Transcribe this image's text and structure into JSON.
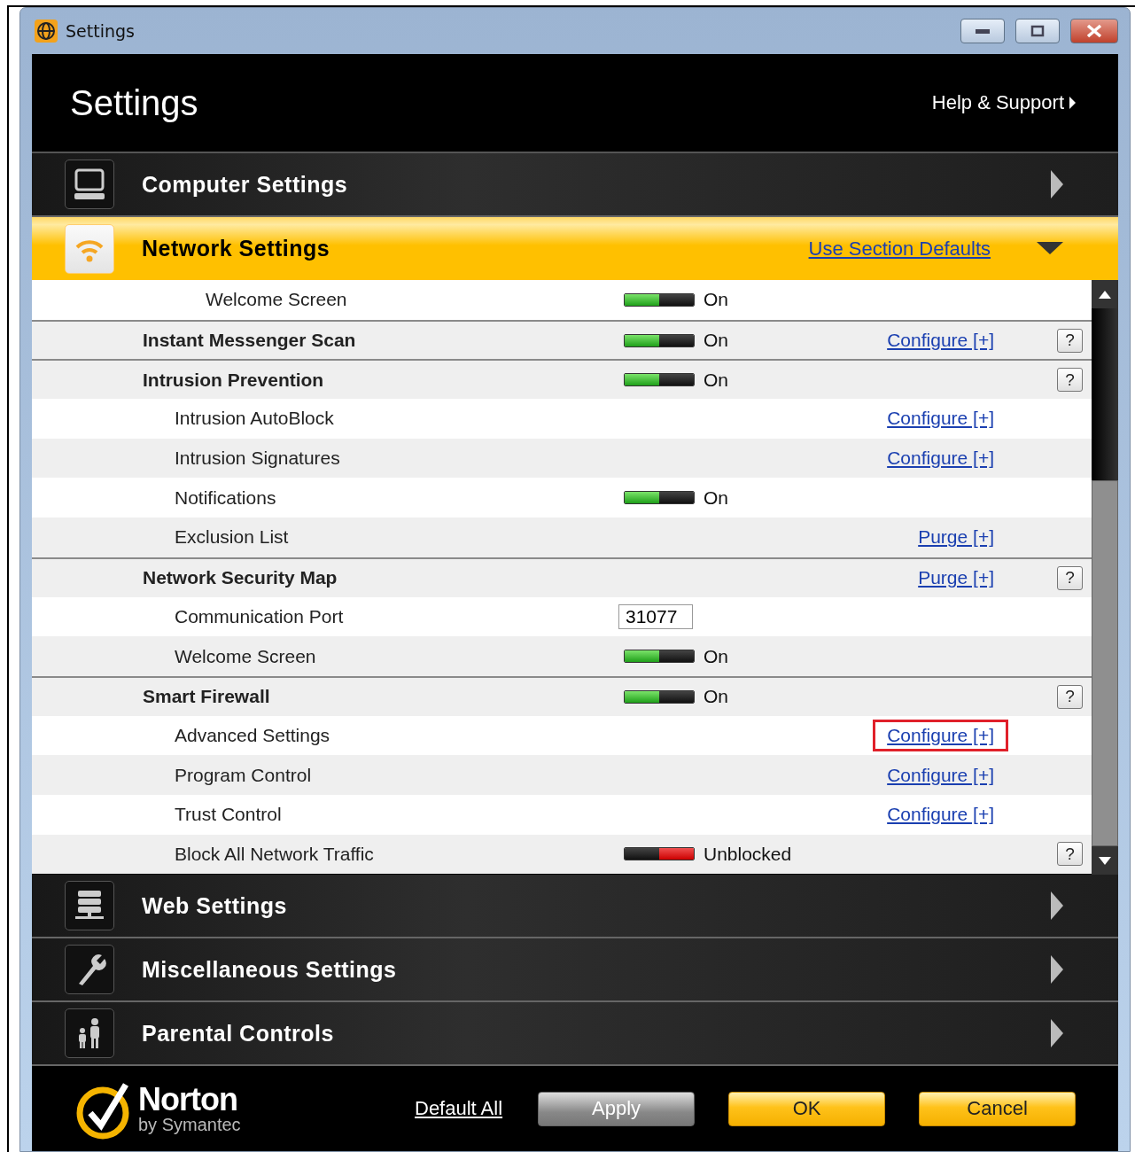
{
  "window": {
    "title": "Settings"
  },
  "header": {
    "title": "Settings",
    "help_link": "Help & Support"
  },
  "sections": [
    {
      "label": "Computer Settings",
      "expanded": false
    },
    {
      "label": "Network Settings",
      "expanded": true,
      "defaults_link": "Use Section Defaults",
      "rows": [
        {
          "kind": "continued",
          "children": [
            {
              "label": "Welcome Screen",
              "toggle": {
                "on": true,
                "text": "On"
              }
            }
          ]
        },
        {
          "kind": "main",
          "label": "Instant Messenger Scan",
          "toggle": {
            "on": true,
            "text": "On"
          },
          "link": "Configure [+]",
          "help": "?"
        },
        {
          "kind": "main",
          "label": "Intrusion Prevention",
          "toggle": {
            "on": true,
            "text": "On"
          },
          "help": "?",
          "children": [
            {
              "label": "Intrusion AutoBlock",
              "link": "Configure [+]"
            },
            {
              "label": "Intrusion Signatures",
              "link": "Configure [+]"
            },
            {
              "label": "Notifications",
              "toggle": {
                "on": true,
                "text": "On"
              }
            },
            {
              "label": "Exclusion List",
              "link": "Purge [+]"
            }
          ]
        },
        {
          "kind": "main",
          "label": "Network Security Map",
          "link": "Purge [+]",
          "help": "?",
          "children": [
            {
              "label": "Communication Port",
              "value": "31077"
            },
            {
              "label": "Welcome Screen",
              "toggle": {
                "on": true,
                "text": "On"
              }
            }
          ]
        },
        {
          "kind": "main",
          "label": "Smart Firewall",
          "toggle": {
            "on": true,
            "text": "On"
          },
          "help": "?",
          "children": [
            {
              "label": "Advanced Settings",
              "link": "Configure [+]",
              "highlighted": true
            },
            {
              "label": "Program Control",
              "link": "Configure [+]"
            },
            {
              "label": "Trust Control",
              "link": "Configure [+]"
            },
            {
              "label": "Block All Network Traffic",
              "toggle": {
                "on": false,
                "text": "Unblocked"
              },
              "help": "?"
            }
          ]
        }
      ]
    },
    {
      "label": "Web Settings",
      "expanded": false
    },
    {
      "label": "Miscellaneous Settings",
      "expanded": false
    },
    {
      "label": "Parental Controls",
      "expanded": false
    }
  ],
  "footer": {
    "brand": "Norton",
    "brand_sub": "by Symantec",
    "default_link": "Default All",
    "buttons": [
      {
        "label": "Apply",
        "kind": "gray"
      },
      {
        "label": "OK",
        "kind": "yellow"
      },
      {
        "label": "Cancel",
        "kind": "yellow"
      }
    ]
  }
}
